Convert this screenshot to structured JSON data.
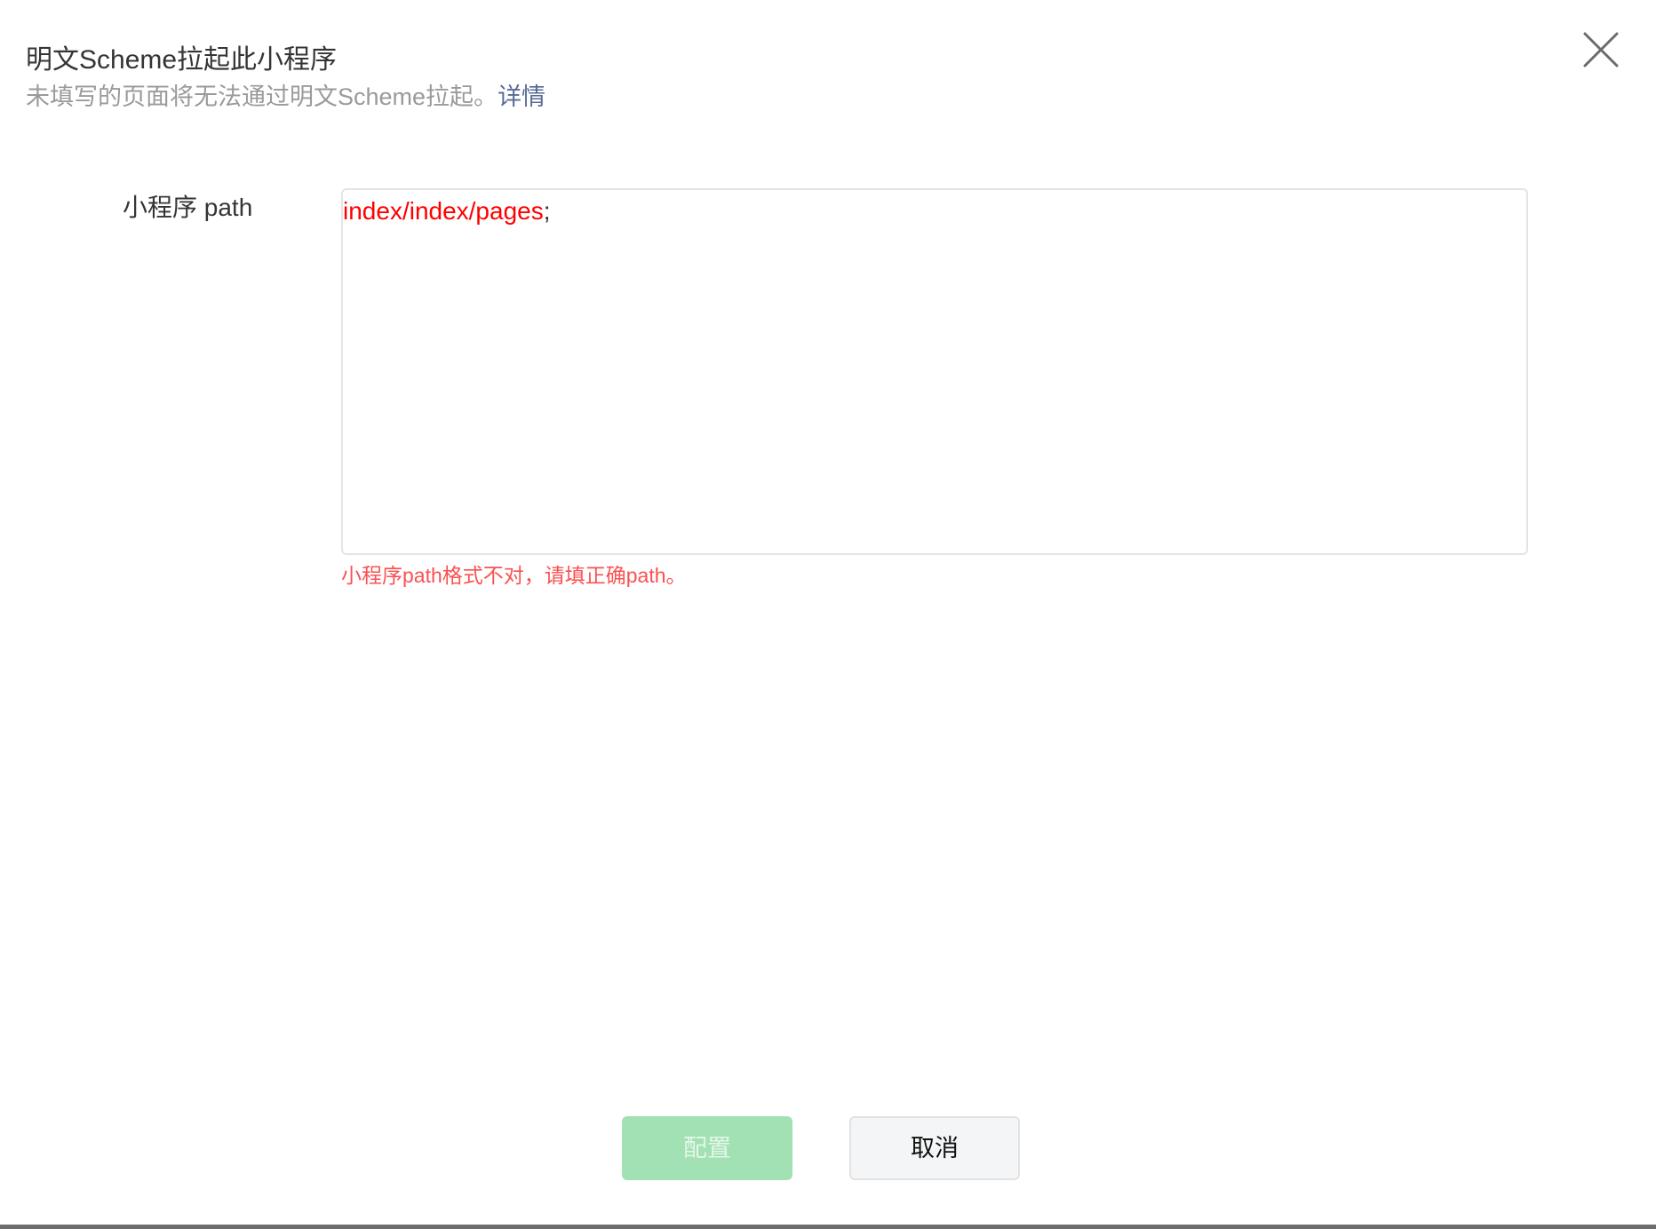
{
  "dialog": {
    "title": "明文Scheme拉起此小程序",
    "subtitle": "未填写的页面将无法通过明文Scheme拉起。",
    "subtitle_link": "详情",
    "close_icon": "close-icon"
  },
  "form": {
    "path_label": "小程序 path",
    "path_value_error_part": "index/index/pages",
    "path_value_rest": ";",
    "error_message": "小程序path格式不对，请填正确path。"
  },
  "footer": {
    "confirm_label": "配置",
    "cancel_label": "取消"
  },
  "colors": {
    "accent_link": "#576b95",
    "error": "#fa5151",
    "error_text": "#ff0000",
    "primary_disabled": "#a2e1b3"
  }
}
